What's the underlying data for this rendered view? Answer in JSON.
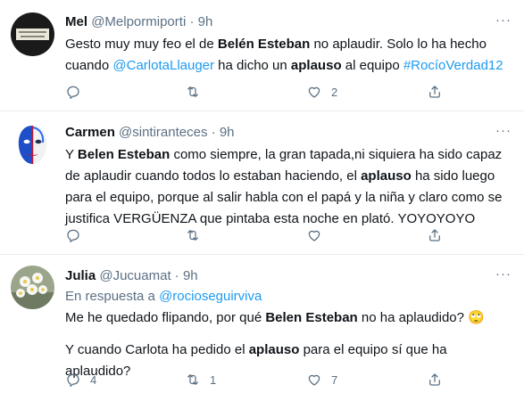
{
  "tweets": [
    {
      "name": "Mel",
      "handle": "@Melpormiporti",
      "separator": "·",
      "time": "9h",
      "text": [
        {
          "t": "Gesto muy muy feo el de "
        },
        {
          "t": "Belén Esteban",
          "style": "bold"
        },
        {
          "t": " no aplaudir. Solo lo ha hecho cuando "
        },
        {
          "t": "@CarlotaLlauger",
          "style": "link"
        },
        {
          "t": " ha dicho un "
        },
        {
          "t": "aplauso",
          "style": "bold"
        },
        {
          "t": " al equipo "
        },
        {
          "t": "#RocíoVerdad12",
          "style": "link"
        }
      ],
      "replies": "",
      "retweets": "",
      "likes": "2"
    },
    {
      "name": "Carmen",
      "handle": "@sintiranteces",
      "separator": "·",
      "time": "9h",
      "text": [
        {
          "t": "Y "
        },
        {
          "t": "Belen Esteban",
          "style": "bold"
        },
        {
          "t": " como siempre,  la gran tapada,ni siquiera ha sido capaz de aplaudir cuando todos lo estaban haciendo, el "
        },
        {
          "t": "aplauso",
          "style": "bold"
        },
        {
          "t": " ha sido luego para el equipo, porque al salir habla con el papá y la niña y claro como se justifica VERGÜENZA que pintaba esta noche en plató. YOYOYOYO"
        }
      ],
      "replies": "",
      "retweets": "",
      "likes": ""
    },
    {
      "name": "Julia",
      "handle": "@Jucuamat",
      "separator": "·",
      "time": "9h",
      "reply_prefix": "En respuesta a",
      "reply_to": "@rocioseguirviva",
      "text_line1": [
        {
          "t": "Me he quedado flipando, por qué "
        },
        {
          "t": "Belen Esteban",
          "style": "bold"
        },
        {
          "t": " no ha aplaudido? 🙄"
        }
      ],
      "text_line2": [
        {
          "t": "Y cuando Carlota ha pedido el "
        },
        {
          "t": "aplauso",
          "style": "bold"
        },
        {
          "t": " para el equipo sí que ha aplaudido?"
        }
      ],
      "replies": "4",
      "retweets": "1",
      "likes": "7"
    }
  ],
  "icons": {
    "reply": "reply-icon",
    "retweet": "retweet-icon",
    "like": "heart-icon",
    "share": "share-icon",
    "more": "more-icon"
  },
  "colors": {
    "link": "#1d9bf0",
    "secondary_text": "#5b7083",
    "divider": "#e6ecf0"
  }
}
